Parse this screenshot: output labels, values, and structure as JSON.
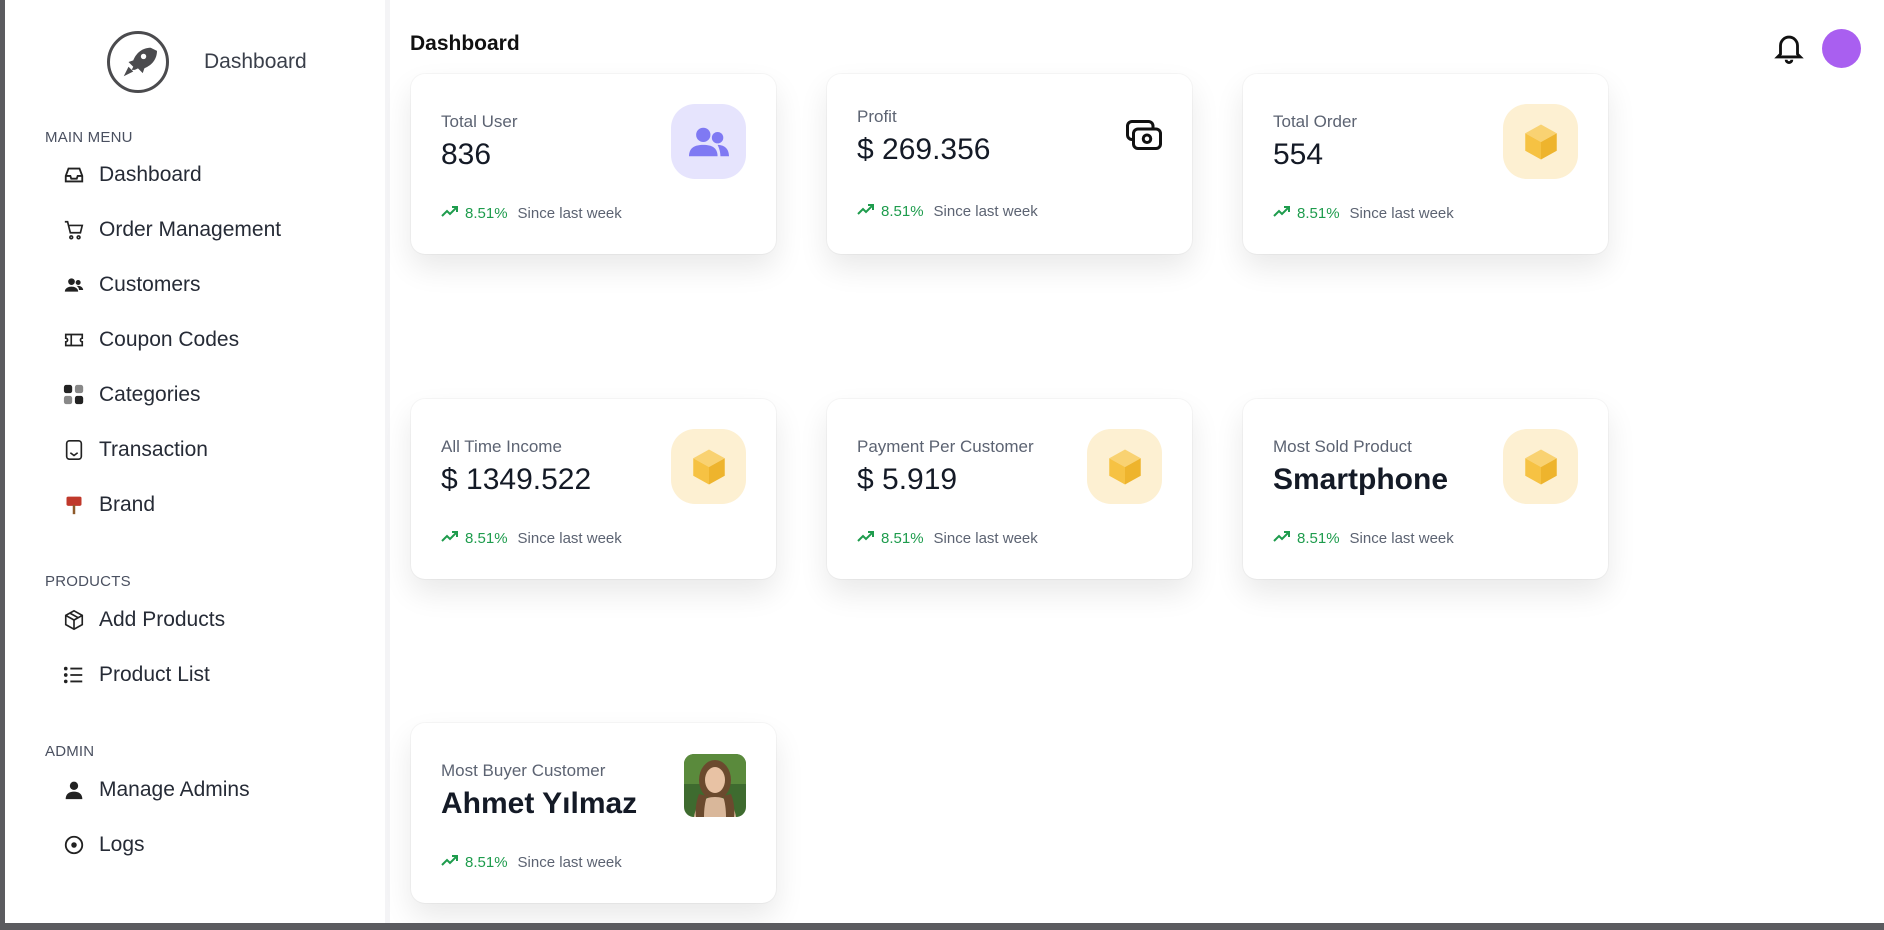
{
  "sidebar": {
    "brand_title": "Dashboard",
    "sections": {
      "main_menu": "MAIN MENU",
      "products": "PRODUCTS",
      "admin": "ADMIN"
    },
    "items": [
      {
        "label": "Dashboard",
        "icon": "inbox-icon"
      },
      {
        "label": "Order Management",
        "icon": "cart-icon"
      },
      {
        "label": "Customers",
        "icon": "users-icon"
      },
      {
        "label": "Coupon Codes",
        "icon": "ticket-icon"
      },
      {
        "label": "Categories",
        "icon": "grid-icon"
      },
      {
        "label": "Transaction",
        "icon": "receipt-icon"
      },
      {
        "label": "Brand",
        "icon": "signpost-icon"
      },
      {
        "label": "Add Products",
        "icon": "box-icon"
      },
      {
        "label": "Product List",
        "icon": "list-icon"
      },
      {
        "label": "Manage Admins",
        "icon": "person-icon"
      },
      {
        "label": "Logs",
        "icon": "clock-icon"
      }
    ]
  },
  "header": {
    "title": "Dashboard"
  },
  "cards": [
    {
      "label": "Total User",
      "value": "836",
      "pct": "8.51%",
      "since": "Since last week",
      "icon": "users-icon"
    },
    {
      "label": "Profit",
      "value": "$ 269.356",
      "pct": "8.51%",
      "since": "Since last week",
      "icon": "money-icon"
    },
    {
      "label": "Total Order",
      "value": "554",
      "pct": "8.51%",
      "since": "Since last week",
      "icon": "cube-icon"
    },
    {
      "label": "All Time Income",
      "value": "$ 1349.522",
      "pct": "8.51%",
      "since": "Since last week",
      "icon": "cube-icon"
    },
    {
      "label": "Payment Per Customer",
      "value": "$ 5.919",
      "pct": "8.51%",
      "since": "Since last week",
      "icon": "cube-icon"
    },
    {
      "label": "Most Sold Product",
      "value": "Smartphone",
      "pct": "8.51%",
      "since": "Since last week",
      "icon": "cube-icon"
    },
    {
      "label": "Most Buyer Customer",
      "value": "Ahmet Yılmaz",
      "pct": "8.51%",
      "since": "Since last week",
      "icon": "customer-photo"
    }
  ],
  "colors": {
    "trend_green": "#1e9c4d",
    "avatar_purple": "#a95ff0",
    "users_icon_bg": "#e6e4fd",
    "users_icon_fg": "#7f79f3",
    "cube_bg": "#fdf0d2",
    "cube_fg": "#f6c243"
  }
}
